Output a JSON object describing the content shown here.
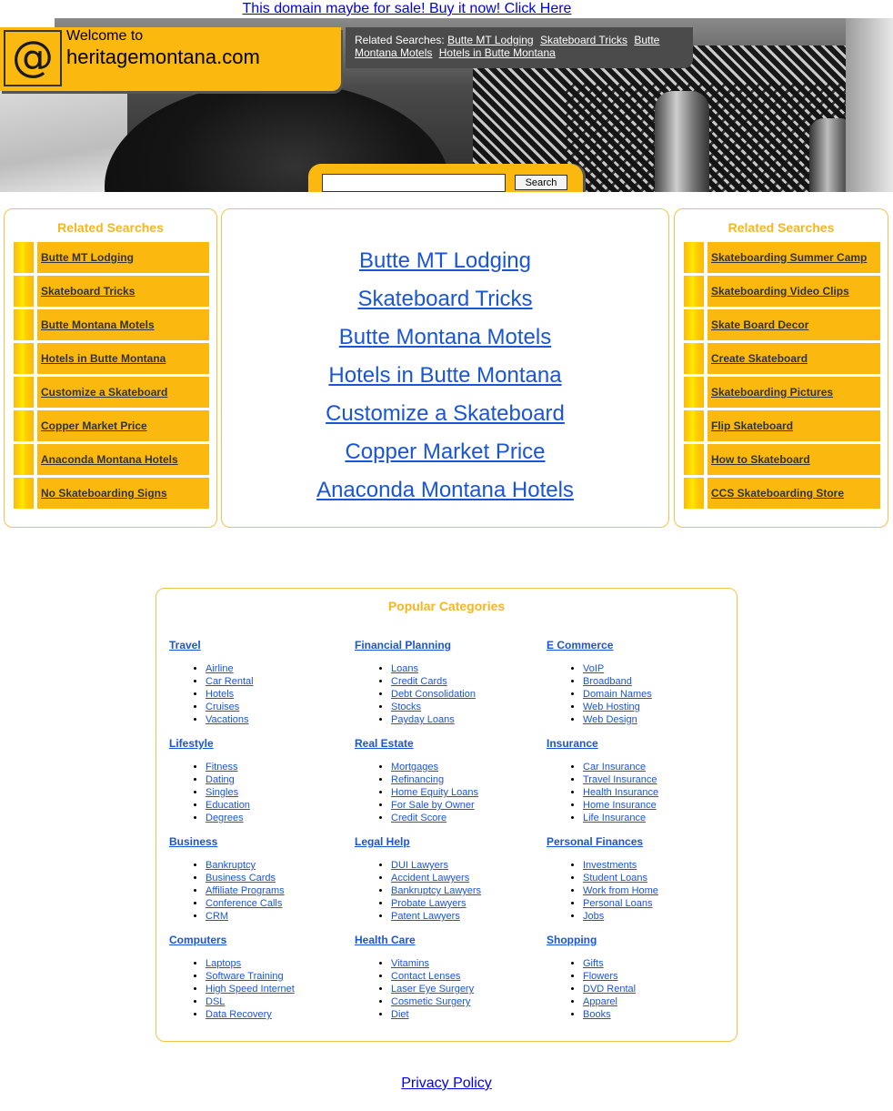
{
  "top_banner": {
    "text": "This domain maybe for sale! Buy it now! Click Here"
  },
  "header": {
    "welcome": "Welcome to",
    "domain": "heritagemontana.com",
    "at_icon": "at-sign-icon",
    "related_prefix": "Related Searches:",
    "related_links": [
      "Butte MT Lodging",
      "Skateboard Tricks",
      "Butte Montana Motels",
      "Hotels in Butte Montana"
    ]
  },
  "search": {
    "value": "",
    "button": "Search"
  },
  "left_panel": {
    "title": "Related Searches",
    "items": [
      "Butte MT Lodging",
      "Skateboard Tricks",
      "Butte Montana Motels",
      "Hotels in Butte Montana",
      "Customize a Skateboard",
      "Copper Market Price",
      "Anaconda Montana Hotels",
      "No Skateboarding Signs"
    ]
  },
  "center_panel": {
    "links": [
      "Butte MT Lodging",
      "Skateboard Tricks",
      "Butte Montana Motels",
      "Hotels in Butte Montana",
      "Customize a Skateboard",
      "Copper Market Price",
      "Anaconda Montana Hotels"
    ]
  },
  "right_panel": {
    "title": "Related Searches",
    "items": [
      "Skateboarding Summer Camp",
      "Skateboarding Video Clips",
      "Skate Board Decor",
      "Create Skateboard",
      "Skateboarding Pictures",
      "Flip Skateboard",
      "How to Skateboard",
      "CCS Skateboarding Store"
    ]
  },
  "popular": {
    "title": "Popular Categories",
    "columns": [
      [
        {
          "title": "Travel",
          "items": [
            "Airline",
            "Car Rental",
            "Hotels",
            "Cruises",
            "Vacations"
          ]
        },
        {
          "title": "Lifestyle",
          "items": [
            "Fitness",
            "Dating",
            "Singles",
            "Education",
            "Degrees"
          ]
        },
        {
          "title": "Business",
          "items": [
            "Bankruptcy",
            "Business Cards",
            "Affiliate Programs",
            "Conference Calls",
            "CRM"
          ]
        },
        {
          "title": "Computers",
          "items": [
            "Laptops",
            "Software Training",
            "High Speed Internet",
            "DSL",
            "Data Recovery"
          ]
        }
      ],
      [
        {
          "title": "Financial Planning",
          "items": [
            "Loans",
            "Credit Cards",
            "Debt Consolidation",
            "Stocks",
            "Payday Loans"
          ]
        },
        {
          "title": "Real Estate",
          "items": [
            "Mortgages",
            "Refinancing",
            "Home Equity Loans",
            "For Sale by Owner",
            "Credit Score"
          ]
        },
        {
          "title": "Legal Help",
          "items": [
            "DUI Lawyers",
            "Accident Lawyers",
            "Bankruptcy Lawyers",
            "Probate Lawyers",
            "Patent Lawyers"
          ]
        },
        {
          "title": "Health Care",
          "items": [
            "Vitamins",
            "Contact Lenses",
            "Laser Eye Surgery",
            "Cosmetic Surgery",
            "Diet"
          ]
        }
      ],
      [
        {
          "title": "E Commerce",
          "items": [
            "VoIP",
            "Broadband",
            "Domain Names",
            "Web Hosting",
            "Web Design"
          ]
        },
        {
          "title": "Insurance",
          "items": [
            "Car Insurance",
            "Travel Insurance",
            "Health Insurance",
            "Home Insurance",
            "Life Insurance"
          ]
        },
        {
          "title": "Personal Finances",
          "items": [
            "Investments",
            "Student Loans",
            "Work from Home",
            "Personal Loans",
            "Jobs"
          ]
        },
        {
          "title": "Shopping",
          "items": [
            "Gifts",
            "Flowers",
            "DVD Rental",
            "Apparel",
            "Books"
          ]
        }
      ]
    ]
  },
  "footer": {
    "privacy": "Privacy Policy"
  },
  "colors": {
    "accent": "#fbb80f",
    "title_orange": "#f5b622",
    "link_blue": "#1a55d8",
    "dark_bar": "#4b4b4b"
  }
}
